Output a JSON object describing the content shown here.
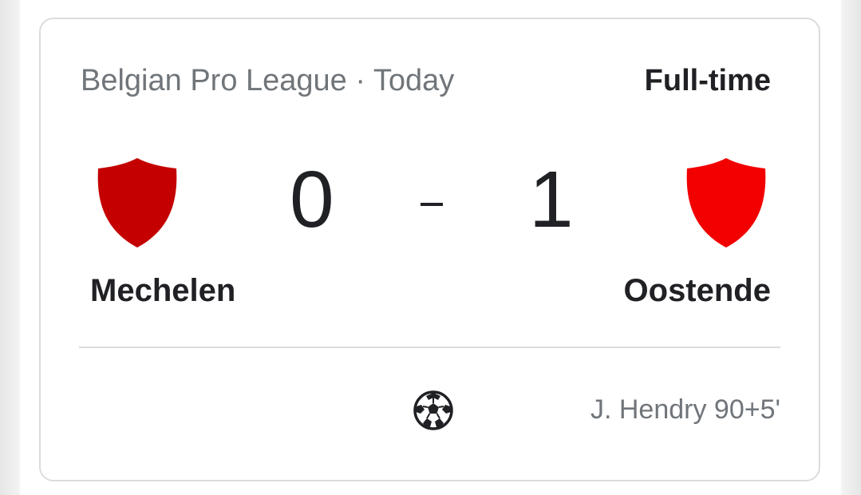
{
  "match": {
    "league_label": "Belgian Pro League · Today",
    "status": "Full-time",
    "home": {
      "name": "Mechelen",
      "score": "0",
      "crest_color": "#c40000",
      "crest_icon": "shield-icon"
    },
    "away": {
      "name": "Oostende",
      "score": "1",
      "crest_color": "#f20000",
      "crest_icon": "shield-icon"
    },
    "score_separator": "-"
  },
  "events": [
    {
      "icon": "soccer-ball-icon",
      "text": "J. Hendry 90+5'"
    }
  ],
  "colors": {
    "card_border": "#dadce0",
    "secondary_text": "#70757a",
    "primary_text": "#202124"
  }
}
